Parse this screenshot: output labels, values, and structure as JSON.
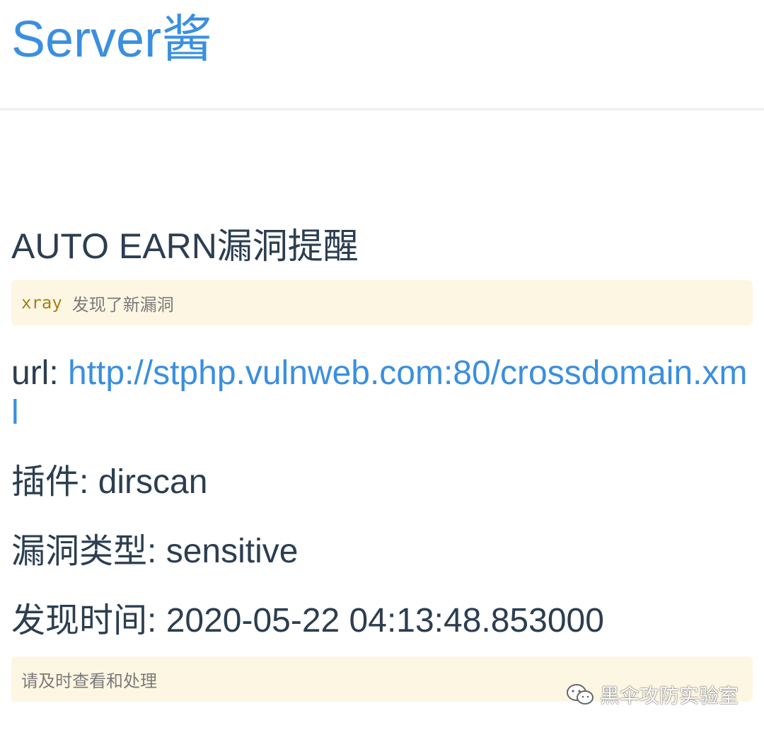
{
  "header": {
    "site_title": "Server酱"
  },
  "message": {
    "heading": "AUTO EARN漏洞提醒",
    "note_code": "xray",
    "note_text": "发现了新漏洞",
    "url_label": "url: ",
    "url_value": "http://stphp.vulnweb.com:80/crossdomain.xml",
    "plugin_label": "插件: ",
    "plugin_value": "dirscan",
    "vuln_type_label": "漏洞类型: ",
    "vuln_type_value": "sensitive",
    "found_time_label": "发现时间: ",
    "found_time_value": "2020-05-22 04:13:48.853000",
    "footer_note": "请及时查看和处理"
  },
  "watermark": {
    "text": "黑伞攻防实验室",
    "icon": "wechat-icon"
  },
  "colors": {
    "accent": "#3a8fe0",
    "text": "#2c3e50",
    "note_bg": "#fdf6e3",
    "code": "#a4801a"
  }
}
